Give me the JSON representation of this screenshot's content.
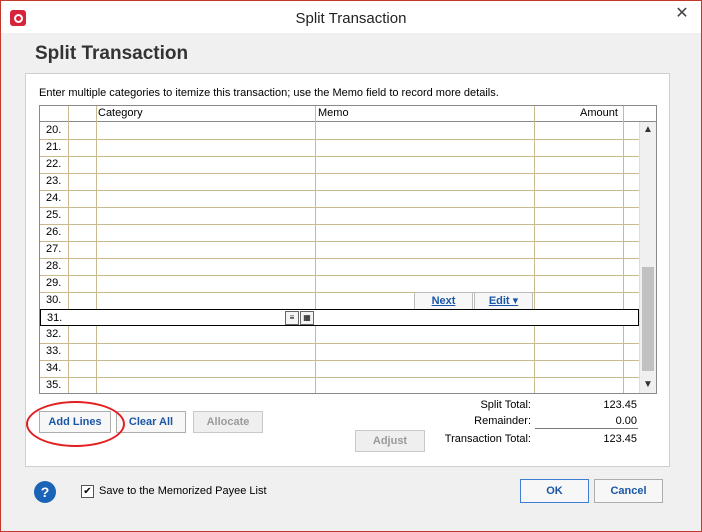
{
  "window": {
    "title": "Split Transaction",
    "close_glyph": "✕"
  },
  "heading": "Split Transaction",
  "instructions": "Enter multiple categories to itemize this transaction; use the Memo field to record more details.",
  "grid": {
    "headers": {
      "category": "Category",
      "memo": "Memo",
      "amount": "Amount"
    },
    "rows": [
      "20.",
      "21.",
      "22.",
      "23.",
      "24.",
      "25.",
      "26.",
      "27.",
      "28.",
      "29.",
      "30.",
      "31.",
      "32.",
      "33.",
      "34.",
      "35."
    ],
    "active_row": "31.",
    "row_buttons": {
      "next": "Next",
      "edit": "Edit ▾"
    }
  },
  "buttons": {
    "add_lines": "Add Lines",
    "clear_all": "Clear All",
    "allocate": "Allocate",
    "adjust": "Adjust",
    "ok": "OK",
    "cancel": "Cancel"
  },
  "totals": {
    "split_total_label": "Split Total:",
    "split_total_value": "123.45",
    "remainder_label": "Remainder:",
    "remainder_value": "0.00",
    "transaction_total_label": "Transaction Total:",
    "transaction_total_value": "123.45"
  },
  "footer": {
    "memorize_label": "Save to the Memorized Payee List",
    "memorize_checked": true,
    "help_glyph": "?"
  },
  "colors": {
    "accent": "#1a56a6",
    "annotation": "#e02020",
    "brand": "#d6243c"
  }
}
